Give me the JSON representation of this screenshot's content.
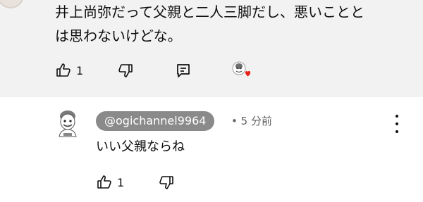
{
  "top_comment": {
    "text_line1": "井上尚弥だって父親と二人三脚だし、悪いことと",
    "text_line2": "は思わないけどな。",
    "like_count": "1",
    "icons": {
      "like": "thumbs-up-icon",
      "dislike": "thumbs-down-icon",
      "reply": "reply-icon",
      "creator_heart": "creator-heart-avatar-icon"
    },
    "heart_color": "#e62117"
  },
  "reply": {
    "handle": "@ogichannel9964",
    "separator": "•",
    "time": "5 分前",
    "text": "いい父親ならね",
    "like_count": "1",
    "icons": {
      "more": "more-vertical-icon",
      "like": "thumbs-up-icon",
      "dislike": "thumbs-down-icon"
    },
    "handle_pill_color": "#8a8a8a"
  }
}
